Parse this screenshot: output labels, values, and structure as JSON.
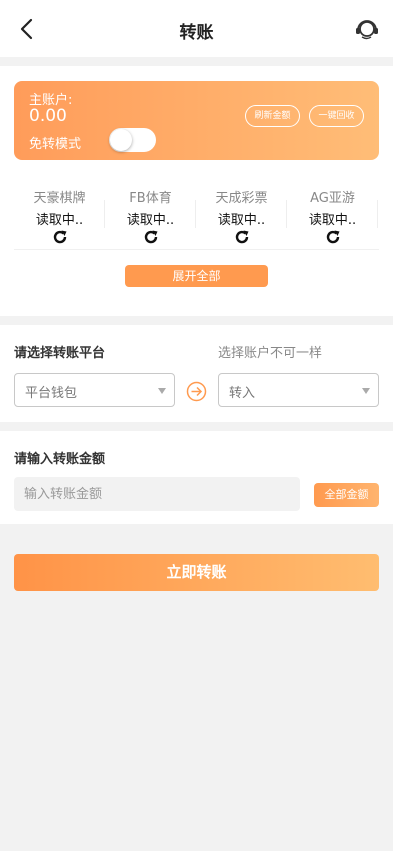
{
  "header": {
    "title": "转账"
  },
  "main_wallet": {
    "label": "主账户:",
    "balance": "0.00",
    "mode_label": "免转模式",
    "mode_enabled": false,
    "refresh_label": "刷新金额",
    "recover_label": "一键回收"
  },
  "platforms": [
    {
      "name": "天豪棋牌",
      "status": "读取中.."
    },
    {
      "name": "FB体育",
      "status": "读取中.."
    },
    {
      "name": "天成彩票",
      "status": "读取中.."
    },
    {
      "name": "AG亚游",
      "status": "读取中.."
    }
  ],
  "expand_label": "展开全部",
  "transfer": {
    "title": "请选择转账平台",
    "hint": "选择账户不可一样",
    "from_value": "平台钱包",
    "to_value": "转入"
  },
  "amount": {
    "title": "请输入转账金额",
    "placeholder": "输入转账金额",
    "all_label": "全部金额"
  },
  "submit_label": "立即转账",
  "colors": {
    "accent": "#ff9a4f",
    "accent_light": "#ffbd77",
    "background": "#f2f2f2"
  }
}
